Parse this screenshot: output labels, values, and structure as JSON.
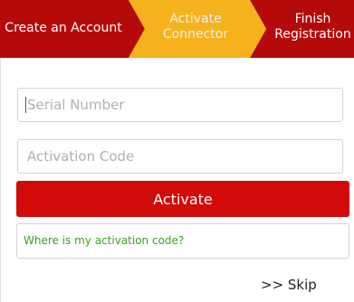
{
  "steps": {
    "step1": {
      "label": "Create an Account",
      "color": "#b50a0a"
    },
    "step2": {
      "line1": "Activate",
      "line2": "Connector",
      "color": "#f5b21c"
    },
    "step3": {
      "line1": "Finish",
      "line2": "Registration",
      "color": "#b50a0a"
    }
  },
  "form": {
    "serial_placeholder": "Serial Number",
    "activation_placeholder": "Activation Code",
    "activate_label": "Activate",
    "activate_color": "#d10a0a",
    "help_link": "Where is my activation code?",
    "help_color": "#3aa21d",
    "skip_label": ">> Skip"
  }
}
